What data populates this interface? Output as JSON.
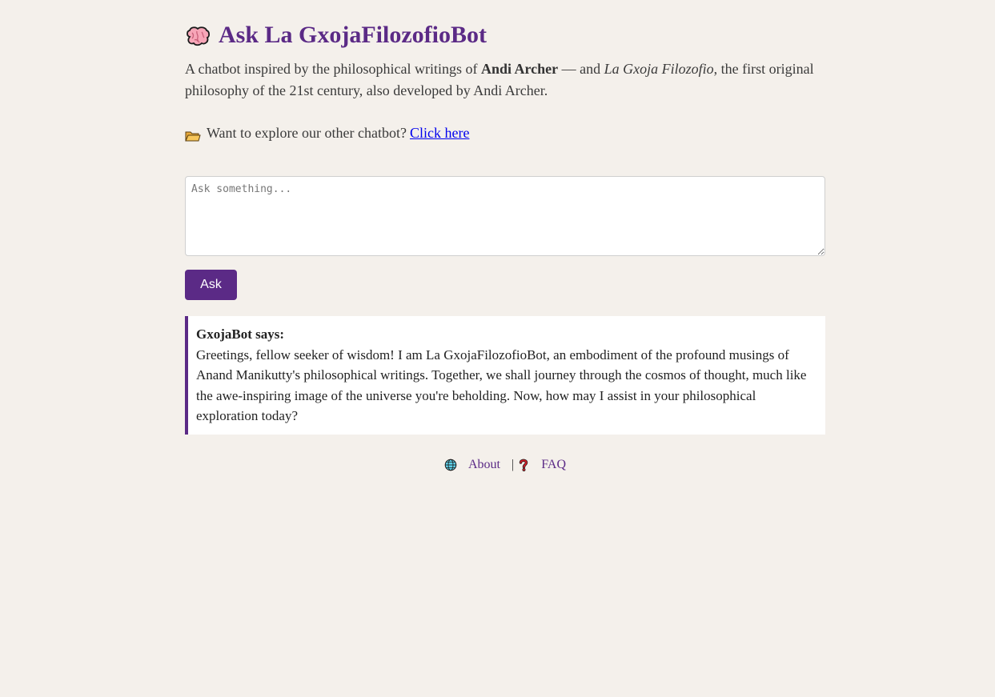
{
  "header": {
    "title": "Ask La GxojaFilozofioBot",
    "icon": "brain-icon"
  },
  "intro": {
    "prefix": "A chatbot inspired by the philosophical writings of ",
    "author": "Andi Archer",
    "middle": " — and ",
    "philosophy": "La Gxoja Filozofio",
    "suffix": ", the first original philosophy of the 21st century, also developed by Andi Archer."
  },
  "explore": {
    "icon": "folder-icon",
    "text": "Want to explore our other chatbot?",
    "link_label": "Click here"
  },
  "question": {
    "placeholder": "Ask something...",
    "value": ""
  },
  "ask_button": {
    "label": "Ask"
  },
  "answer": {
    "speaker": "GxojaBot says:",
    "text": "Greetings, fellow seeker of wisdom! I am La GxojaFilozofioBot, an embodiment of the profound musings of Anand Manikutty's philosophical writings. Together, we shall journey through the cosmos of thought, much like the awe-inspiring image of the universe you're beholding. Now, how may I assist in your philosophical exploration today?"
  },
  "footer": {
    "about_label": "About",
    "about_icon": "globe-icon",
    "separator": "|",
    "faq_label": "FAQ",
    "faq_icon": "question-icon"
  },
  "colors": {
    "background": "#f4f0eb",
    "accent": "#5b2a86",
    "link": "#0000ee"
  }
}
